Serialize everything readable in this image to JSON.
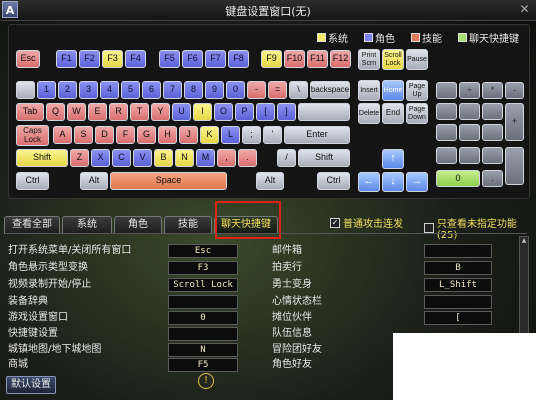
{
  "window": {
    "title": "键盘设置窗口(无)",
    "corner_label": "A",
    "close_glyph": "✕"
  },
  "legend": [
    {
      "label": "系统",
      "color": "#f2ea6a"
    },
    {
      "label": "角色",
      "color": "#7a7ff0"
    },
    {
      "label": "技能",
      "color": "#e07a5a"
    },
    {
      "label": "聊天快捷键",
      "color": "#a8e070"
    }
  ],
  "keys": {
    "esc": "Esc",
    "f1": "F1",
    "f2": "F2",
    "f3": "F3",
    "f4": "F4",
    "f5": "F5",
    "f6": "F6",
    "f7": "F7",
    "f8": "F8",
    "f9": "F9",
    "f10": "F10",
    "f11": "F11",
    "f12": "F12",
    "printscrn": "Print\nScrn",
    "scrolllock": "Scroll\nLock",
    "pause": "Pause",
    "num1": "1",
    "num2": "2",
    "num3": "3",
    "num4": "4",
    "num5": "5",
    "num6": "6",
    "num7": "7",
    "num8": "8",
    "num9": "9",
    "num0": "0",
    "minus": "-",
    "equals": "=",
    "backslash": "\\",
    "backspace": "backspace",
    "insert": "Insert",
    "home": "Home",
    "pageup": "Page\nUp",
    "np_div": "÷",
    "np_mul": "*",
    "np_minus": "-",
    "tab": "Tab",
    "q": "Q",
    "w": "W",
    "e": "E",
    "r": "R",
    "t": "T",
    "y": "Y",
    "u": "U",
    "i": "I",
    "o": "O",
    "p": "P",
    "lbracket": "[",
    "rbracket": "]",
    "delete": "Delete",
    "end": "End",
    "pagedown": "Page\nDown",
    "np_plus": "+",
    "capslock": "Caps\nLock",
    "a": "A",
    "s": "S",
    "d": "D",
    "f": "F",
    "g": "G",
    "h": "H",
    "j": "J",
    "k": "K",
    "l": "L",
    "semicolon": ";",
    "quote": "'",
    "enter": "Enter",
    "shift_l": "Shift",
    "z": "Z",
    "x": "X",
    "c": "C",
    "v": "V",
    "b": "B",
    "n": "N",
    "m": "M",
    "comma": ",",
    "period": ".",
    "slash": "/",
    "shift_r": "Shift",
    "up": "↑",
    "ctrl_l": "Ctrl",
    "alt_l": "Alt",
    "space": "Space",
    "alt_r": "Alt",
    "ctrl_r": "Ctrl",
    "left": "←",
    "down": "↓",
    "right": "→",
    "np_0": "0",
    "np_dot": "."
  },
  "tabs": [
    "查看全部",
    "系统",
    "角色",
    "技能",
    "聊天快捷键"
  ],
  "active_tab": "聊天快捷键",
  "options": [
    {
      "label": "普通攻击连发",
      "checked": true
    },
    {
      "label": "只查看未指定功能(25)",
      "checked": false
    }
  ],
  "left_list": [
    {
      "label": "打开系统菜单/关闭所有窗口",
      "key": "Esc"
    },
    {
      "label": "角色悬示类型变换",
      "key": "F3"
    },
    {
      "label": "视频录制开始/停止",
      "key": "Scroll Lock"
    },
    {
      "label": "装备辞典",
      "key": ""
    },
    {
      "label": "游戏设置窗口",
      "key": "0"
    },
    {
      "label": "快捷键设置",
      "key": ""
    },
    {
      "label": "城镇地图/地下城地图",
      "key": "N"
    },
    {
      "label": "商城",
      "key": "F5"
    }
  ],
  "right_list": [
    {
      "label": "邮件箱",
      "key": ""
    },
    {
      "label": "拍卖行",
      "key": "B"
    },
    {
      "label": "勇士变身",
      "key": "L_Shift"
    },
    {
      "label": "心情状态栏",
      "key": ""
    },
    {
      "label": "摊位伙伴",
      "key": "["
    },
    {
      "label": "队伍信息",
      "key": ""
    },
    {
      "label": "冒险团好友",
      "key": ""
    },
    {
      "label": "角色好友",
      "key": ""
    }
  ],
  "footer": {
    "default_button": "默认设置",
    "warning_glyph": "!"
  }
}
